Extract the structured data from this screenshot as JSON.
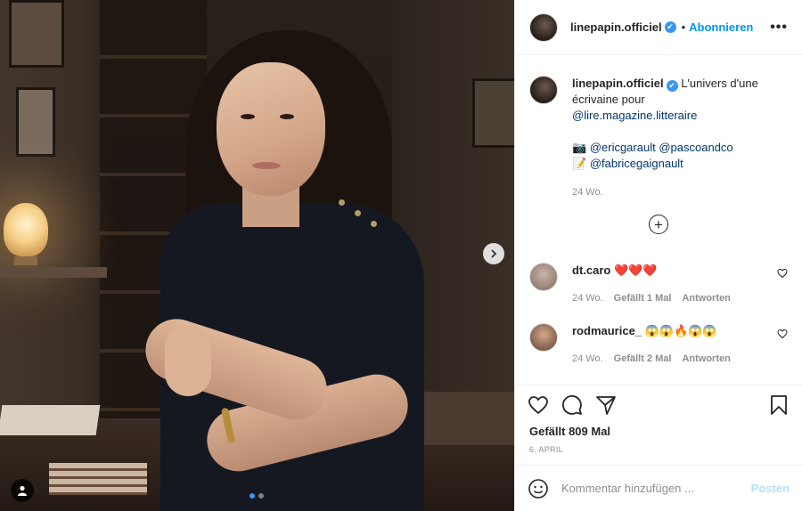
{
  "post": {
    "author": "linepapin.officiel",
    "verified_mark": "✔",
    "separator": "•",
    "follow_label": "Abonnieren",
    "more_label": "•••",
    "caption": {
      "username": "linepapin.officiel",
      "text": "L'univers d'une écrivaine pour",
      "mention_magazine": "@lire.magazine.litteraire",
      "camera_emoji": "📷",
      "mention_1": "@ericgarault",
      "mention_2": "@pascoandco",
      "memo_emoji": "📝",
      "mention_3": "@fabricegaignault",
      "age": "24 Wo."
    },
    "load_more_symbol": "+",
    "comments": [
      {
        "username": "dt.caro",
        "text": "❤️❤️❤️",
        "age": "24 Wo.",
        "likes": "Gefällt 1 Mal",
        "reply": "Antworten"
      },
      {
        "username": "rodmaurice_",
        "text": "😱😱🔥😱😱",
        "age": "24 Wo.",
        "likes": "Gefällt 2 Mal",
        "reply": "Antworten"
      }
    ],
    "likes_count": "Gefällt 809 Mal",
    "date": "6. APRIL",
    "comment_placeholder": "Kommentar hinzufügen ...",
    "post_label": "Posten"
  },
  "carousel": {
    "count": 2,
    "active_index": 0
  },
  "colors": {
    "accent": "#0095f6",
    "verified": "#3897f0",
    "muted": "#8e8e8e"
  }
}
